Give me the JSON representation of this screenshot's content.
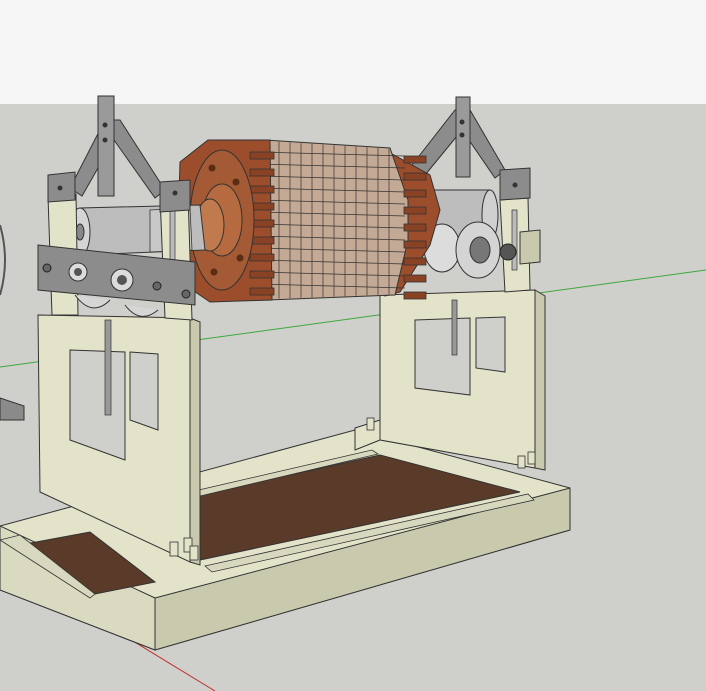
{
  "viewport": {
    "sky_color": "#f6f6f6",
    "ground_color": "#cfd0cb",
    "axis_green": "#3da83d",
    "axis_red": "#c33030"
  },
  "model": {
    "frame_color": "#e3e3c9",
    "frame_shadow": "#c9c9ae",
    "base_top_color": "#5a3a28",
    "copper_color": "#9c4e2c",
    "core_color": "#c4a994",
    "shaft_color": "#bdbdbd",
    "bracket_color": "#8c8c8c"
  }
}
